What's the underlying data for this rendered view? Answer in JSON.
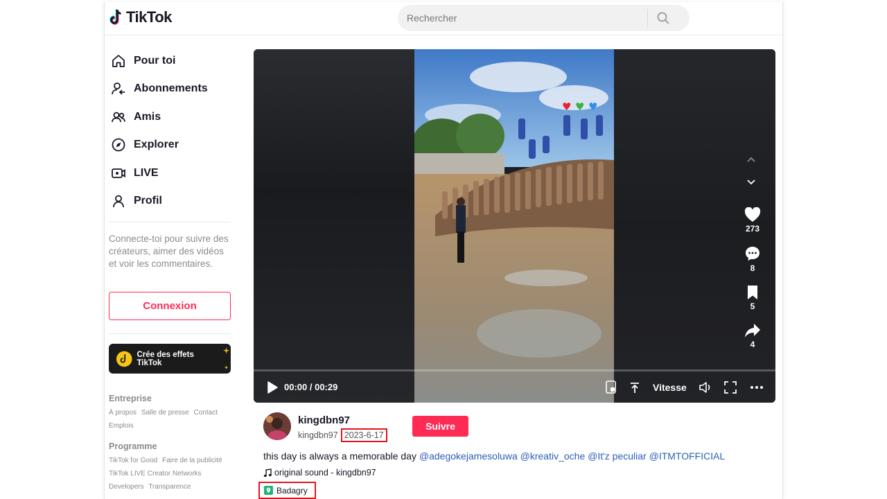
{
  "app": {
    "logo_text": "TikTok"
  },
  "search": {
    "placeholder": "Rechercher"
  },
  "sidebar": {
    "items": [
      {
        "label": "Pour toi",
        "icon": "home-icon"
      },
      {
        "label": "Abonnements",
        "icon": "following-icon"
      },
      {
        "label": "Amis",
        "icon": "friends-icon"
      },
      {
        "label": "Explorer",
        "icon": "compass-icon"
      },
      {
        "label": "LIVE",
        "icon": "live-icon"
      },
      {
        "label": "Profil",
        "icon": "profile-icon"
      }
    ],
    "login_prompt": "Connecte-toi pour suivre des créateurs, aimer des vidéos et voir les commentaires.",
    "login_button": "Connexion",
    "effects_button": "Crée des effets TikTok",
    "footer": {
      "company_heading": "Entreprise",
      "company_links": [
        "À propos",
        "Salle de presse",
        "Contact",
        "Emplois"
      ],
      "program_heading": "Programme",
      "program_links": [
        "TikTok for Good",
        "Faire de la publicité",
        "TikTok LIVE Creator Networks",
        "Developers",
        "Transparence"
      ]
    }
  },
  "video": {
    "time": "00:00 / 00:29",
    "speed_label": "Vitesse",
    "progress": 0.0,
    "actions": [
      {
        "icon": "heart-icon",
        "count": "273"
      },
      {
        "icon": "comment-icon",
        "count": "8"
      },
      {
        "icon": "bookmark-icon",
        "count": "5"
      },
      {
        "icon": "share-icon",
        "count": "4"
      }
    ]
  },
  "post": {
    "author": "kingdbn97",
    "handle": "kingdbn97",
    "date": "2023-6-17",
    "follow_button": "Suivre",
    "caption_text": "this day is always a memorable day",
    "mentions": [
      "@adegokejamesoluwa",
      "@kreativ_oche",
      "@It'z peculiar",
      "@ITMTOFFICIAL"
    ],
    "sound": "original sound - kingdbn97",
    "location": "Badagry"
  },
  "colors": {
    "accent": "#fe2c55",
    "highlight_box": "#e0141e",
    "mention": "#2b5db9"
  }
}
